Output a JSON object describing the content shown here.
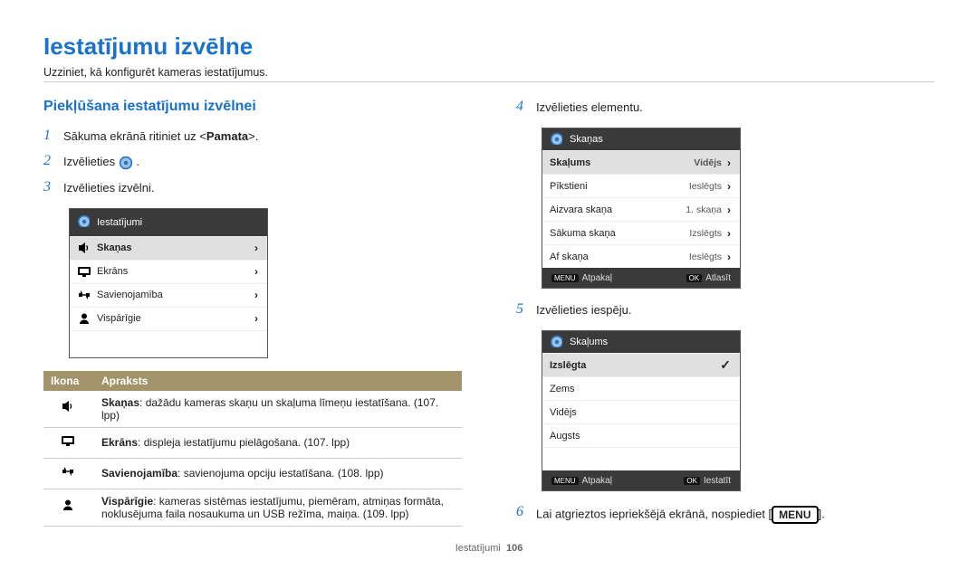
{
  "title": "Iestatījumu izvēlne",
  "intro": "Uzziniet, kā konfigurēt kameras iestatījumus.",
  "left": {
    "subtitle": "Piekļūšana iestatījumu izvēlnei",
    "steps": {
      "1": "Sākuma ekrānā ritiniet uz <Pamata>.",
      "2_pre": "Izvēlieties ",
      "2_post": ".",
      "3": "Izvēlieties izvēlni."
    },
    "camera": {
      "title": "Iestatījumi",
      "rows": [
        {
          "label": "Skaņas",
          "selected": true
        },
        {
          "label": "Ekrāns"
        },
        {
          "label": "Savienojamība"
        },
        {
          "label": "Vispārīgie"
        }
      ]
    },
    "table": {
      "h_icon": "Ikona",
      "h_desc": "Apraksts",
      "rows": [
        {
          "bold": "Skaņas",
          "rest": ": dažādu kameras skaņu un skaļuma līmeņu iestatīšana. (107. lpp)"
        },
        {
          "bold": "Ekrāns",
          "rest": ": displeja iestatījumu pielāgošana. (107. lpp)"
        },
        {
          "bold": "Savienojamība",
          "rest": ": savienojuma opciju iestatīšana. (108. lpp)"
        },
        {
          "bold": "Vispārīgie",
          "rest": ": kameras sistēmas iestatījumu, piemēram, atmiņas formāta, noklusējuma faila nosaukuma un USB režīma, maiņa. (109. lpp)"
        }
      ]
    }
  },
  "right": {
    "steps": {
      "4": "Izvēlieties elementu.",
      "5": "Izvēlieties iespēju.",
      "6_pre": "Lai atgrieztos iepriekšējā ekrānā, nospiediet [",
      "6_badge": "MENU",
      "6_post": "]."
    },
    "camera1": {
      "title": "Skaņas",
      "rows": [
        {
          "label": "Skaļums",
          "val": "Vidējs",
          "selected": true,
          "arrow": true
        },
        {
          "label": "Pīkstieni",
          "val": "Ieslēgts",
          "arrow": true
        },
        {
          "label": "Aizvara skaņa",
          "val": "1. skaņa",
          "arrow": true
        },
        {
          "label": "Sākuma skaņa",
          "val": "Izslēgts",
          "arrow": true
        },
        {
          "label": "Af skaņa",
          "val": "Ieslēgts",
          "arrow": true
        }
      ],
      "footer": {
        "menu": "MENU",
        "back": "Atpakaļ",
        "ok": "OK",
        "action": "Atlasīt"
      }
    },
    "camera2": {
      "title": "Skaļums",
      "rows": [
        {
          "label": "Izslēgta",
          "selected": true,
          "check": true
        },
        {
          "label": "Zems"
        },
        {
          "label": "Vidējs"
        },
        {
          "label": "Augsts"
        }
      ],
      "footer": {
        "menu": "MENU",
        "back": "Atpakaļ",
        "ok": "OK",
        "action": "Iestatīt"
      }
    }
  },
  "footer": {
    "section": "Iestatījumi",
    "page": "106"
  }
}
